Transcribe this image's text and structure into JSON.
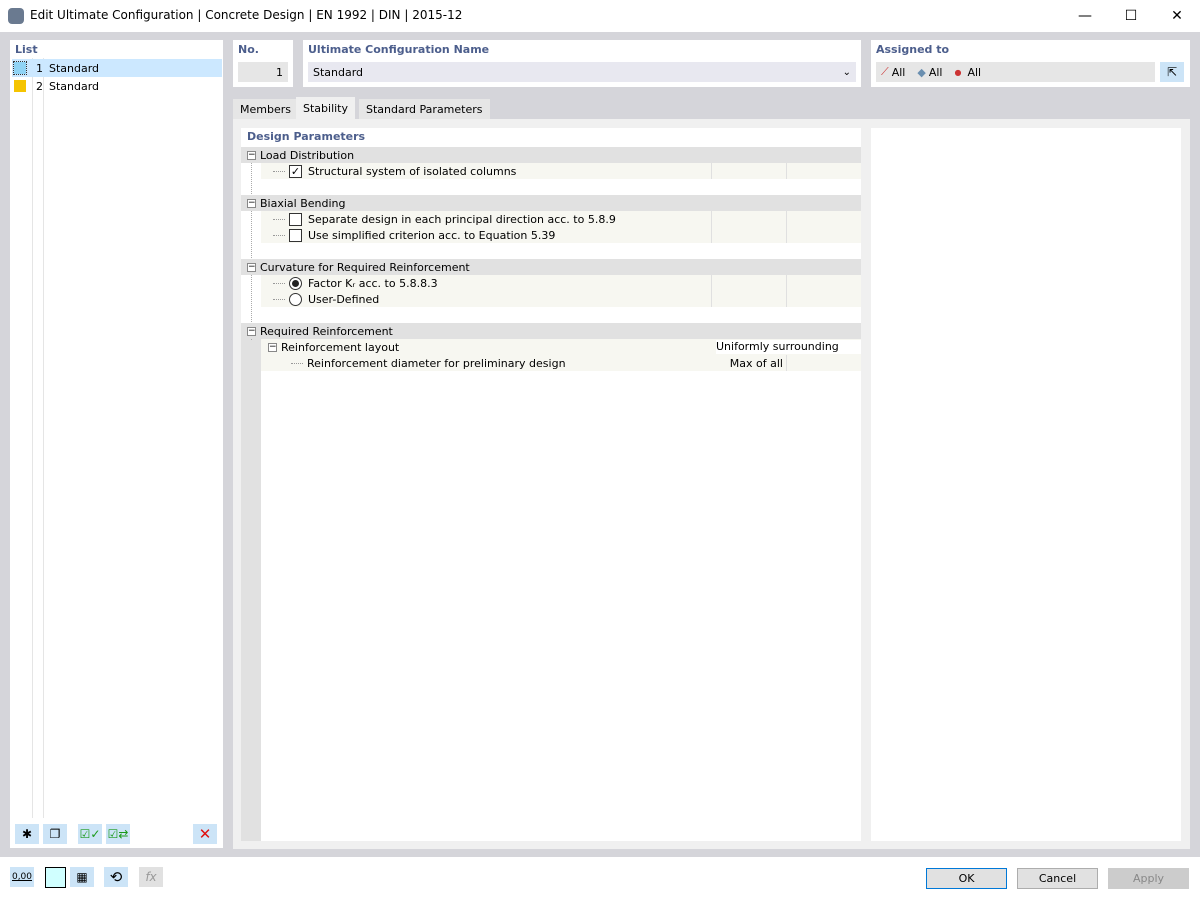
{
  "window": {
    "title": "Edit Ultimate Configuration | Concrete Design | EN 1992 | DIN | 2015-12"
  },
  "list": {
    "label": "List",
    "items": [
      {
        "no": "1",
        "name": "Standard",
        "color": "#8fd3f5"
      },
      {
        "no": "2",
        "name": "Standard",
        "color": "#f5c400"
      }
    ]
  },
  "header": {
    "no_label": "No.",
    "no_value": "1",
    "name_label": "Ultimate Configuration Name",
    "name_value": "Standard",
    "assigned_label": "Assigned to",
    "assigned": [
      "All",
      "All",
      "All"
    ]
  },
  "tabs": [
    "Members",
    "Stability",
    "Standard Parameters"
  ],
  "grid": {
    "title": "Design Parameters",
    "groups": [
      {
        "label": "Load Distribution",
        "items": [
          {
            "label": "Structural system of isolated columns",
            "type": "checkbox",
            "checked": true
          }
        ]
      },
      {
        "label": "Biaxial Bending",
        "items": [
          {
            "label": "Separate design in each principal direction acc. to 5.8.9",
            "type": "checkbox",
            "checked": false
          },
          {
            "label": "Use simplified criterion acc. to Equation 5.39",
            "type": "checkbox",
            "checked": false
          }
        ]
      },
      {
        "label": "Curvature for Required Reinforcement",
        "items": [
          {
            "label": "Factor Kᵣ acc. to 5.8.8.3",
            "type": "radio",
            "checked": true
          },
          {
            "label": "User-Defined",
            "type": "radio",
            "checked": false
          }
        ]
      },
      {
        "label": "Required Reinforcement",
        "items": [
          {
            "label": "Reinforcement layout",
            "value": "Uniformly surrounding"
          },
          {
            "label": "Reinforcement diameter for preliminary design",
            "value": "Max of all"
          }
        ]
      }
    ]
  },
  "buttons": {
    "ok": "OK",
    "cancel": "Cancel",
    "apply": "Apply"
  },
  "bottom_icons": {
    "decimal": "0,00"
  }
}
